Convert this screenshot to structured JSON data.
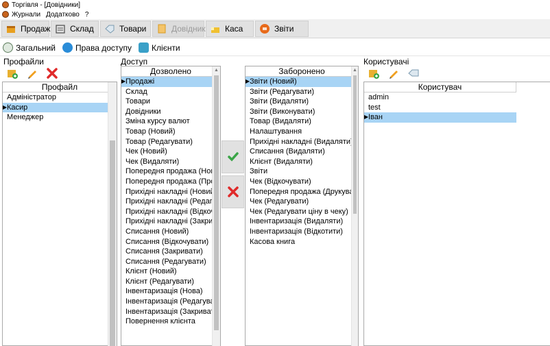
{
  "window": {
    "title": "Торгівля - [Довідники]"
  },
  "menu": {
    "items": [
      "Журнали",
      "Додатково",
      "?"
    ]
  },
  "toolbar": {
    "items": [
      {
        "label": "Продажі",
        "icon": "cart-icon"
      },
      {
        "label": "Склад",
        "icon": "warehouse-icon"
      },
      {
        "label": "Товари",
        "icon": "tag-icon"
      },
      {
        "label": "Довідники",
        "icon": "book-icon"
      },
      {
        "label": "Каса",
        "icon": "cash-icon"
      },
      {
        "label": "Звіти",
        "icon": "report-icon"
      }
    ]
  },
  "subbar": {
    "items": [
      {
        "label": "Загальний",
        "icon": "settings-icon"
      },
      {
        "label": "Права доступу",
        "icon": "user-rights-icon"
      },
      {
        "label": "Клієнти",
        "icon": "clients-icon"
      }
    ]
  },
  "profiles": {
    "title": "Профайли",
    "header": "Профайл",
    "rows": [
      "Адміністратор",
      "Касир",
      "Менеджер"
    ],
    "selected_index": 1
  },
  "access": {
    "title": "Доступ",
    "allowed": {
      "header": "Дозволено",
      "rows": [
        "Продажі",
        "Склад",
        "Товари",
        "Довідники",
        "Зміна курсу валют",
        "Товар (Новий)",
        "Товар (Редагувати)",
        "Чек (Новий)",
        "Чек (Видаляти)",
        "Попередня продажа (Новий)",
        "Попередня продажа (Провод",
        "Прихідні накладні (Новий)",
        "Прихідні накладні (Редагува",
        "Прихідні накладні (Відкочува",
        "Прихідні накладні (Закривати",
        "Списання (Новий)",
        "Списання (Відкочувати)",
        "Списання (Закривати)",
        "Списання (Редагувати)",
        "Клієнт (Новий)",
        "Клієнт (Редагувати)",
        "Інвентаризація (Нова)",
        "Інвентаризація (Редагувати)",
        "Інвентаризація (Закривати)",
        "Повернення клієнта"
      ],
      "selected_index": 0
    },
    "denied": {
      "header": "Заборонено",
      "rows": [
        "Звіти (Новий)",
        "Звіти (Редагувати)",
        "Звіти (Видаляти)",
        "Звіти (Виконувати)",
        "Товар (Видаляти)",
        "Налаштування",
        "Прихідні накладні (Видаляти)",
        "Списання (Видаляти)",
        "Клієнт (Видаляти)",
        "Звіти",
        "Чек (Відкочувати)",
        "Попередня продажа (Друкувати",
        "Чек (Редагувати)",
        "Чек (Редагувати ціну в чеку)",
        "Інвентаризація (Видаляти)",
        "Інвентаризація (Відкотити)",
        "Касова книга"
      ],
      "selected_index": 0
    }
  },
  "users": {
    "title": "Користувачі",
    "header": "Користувач",
    "rows": [
      "admin",
      "test",
      "Іван"
    ],
    "selected_index": 2
  },
  "colors": {
    "selection": "#a8d4f5",
    "accept": "#3aa547",
    "reject": "#e02a2a"
  }
}
